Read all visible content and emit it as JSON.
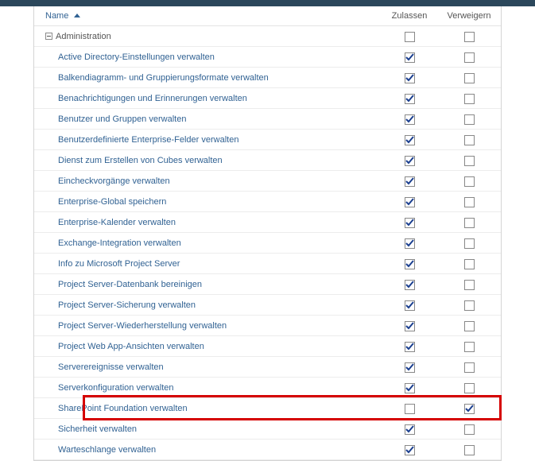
{
  "columns": {
    "name": "Name",
    "allow": "Zulassen",
    "deny": "Verweigern"
  },
  "group": {
    "label": "Administration",
    "allow": false,
    "deny": false
  },
  "items": [
    {
      "label": "Active Directory-Einstellungen verwalten",
      "allow": true,
      "deny": false,
      "highlight": false
    },
    {
      "label": "Balkendiagramm- und Gruppierungsformate verwalten",
      "allow": true,
      "deny": false,
      "highlight": false
    },
    {
      "label": "Benachrichtigungen und Erinnerungen verwalten",
      "allow": true,
      "deny": false,
      "highlight": false
    },
    {
      "label": "Benutzer und Gruppen verwalten",
      "allow": true,
      "deny": false,
      "highlight": false
    },
    {
      "label": "Benutzerdefinierte Enterprise-Felder verwalten",
      "allow": true,
      "deny": false,
      "highlight": false
    },
    {
      "label": "Dienst zum Erstellen von Cubes verwalten",
      "allow": true,
      "deny": false,
      "highlight": false
    },
    {
      "label": "Eincheckvorgänge verwalten",
      "allow": true,
      "deny": false,
      "highlight": false
    },
    {
      "label": "Enterprise-Global speichern",
      "allow": true,
      "deny": false,
      "highlight": false
    },
    {
      "label": "Enterprise-Kalender verwalten",
      "allow": true,
      "deny": false,
      "highlight": false
    },
    {
      "label": "Exchange-Integration verwalten",
      "allow": true,
      "deny": false,
      "highlight": false
    },
    {
      "label": "Info zu Microsoft Project Server",
      "allow": true,
      "deny": false,
      "highlight": false
    },
    {
      "label": "Project Server-Datenbank bereinigen",
      "allow": true,
      "deny": false,
      "highlight": false
    },
    {
      "label": "Project Server-Sicherung verwalten",
      "allow": true,
      "deny": false,
      "highlight": false
    },
    {
      "label": "Project Server-Wiederherstellung verwalten",
      "allow": true,
      "deny": false,
      "highlight": false
    },
    {
      "label": "Project Web App-Ansichten verwalten",
      "allow": true,
      "deny": false,
      "highlight": false
    },
    {
      "label": "Serverereignisse verwalten",
      "allow": true,
      "deny": false,
      "highlight": false
    },
    {
      "label": "Serverkonfiguration verwalten",
      "allow": true,
      "deny": false,
      "highlight": false
    },
    {
      "label": "SharePoint Foundation verwalten",
      "allow": false,
      "deny": true,
      "highlight": true
    },
    {
      "label": "Sicherheit verwalten",
      "allow": true,
      "deny": false,
      "highlight": false
    },
    {
      "label": "Warteschlange verwalten",
      "allow": true,
      "deny": false,
      "highlight": false
    }
  ]
}
